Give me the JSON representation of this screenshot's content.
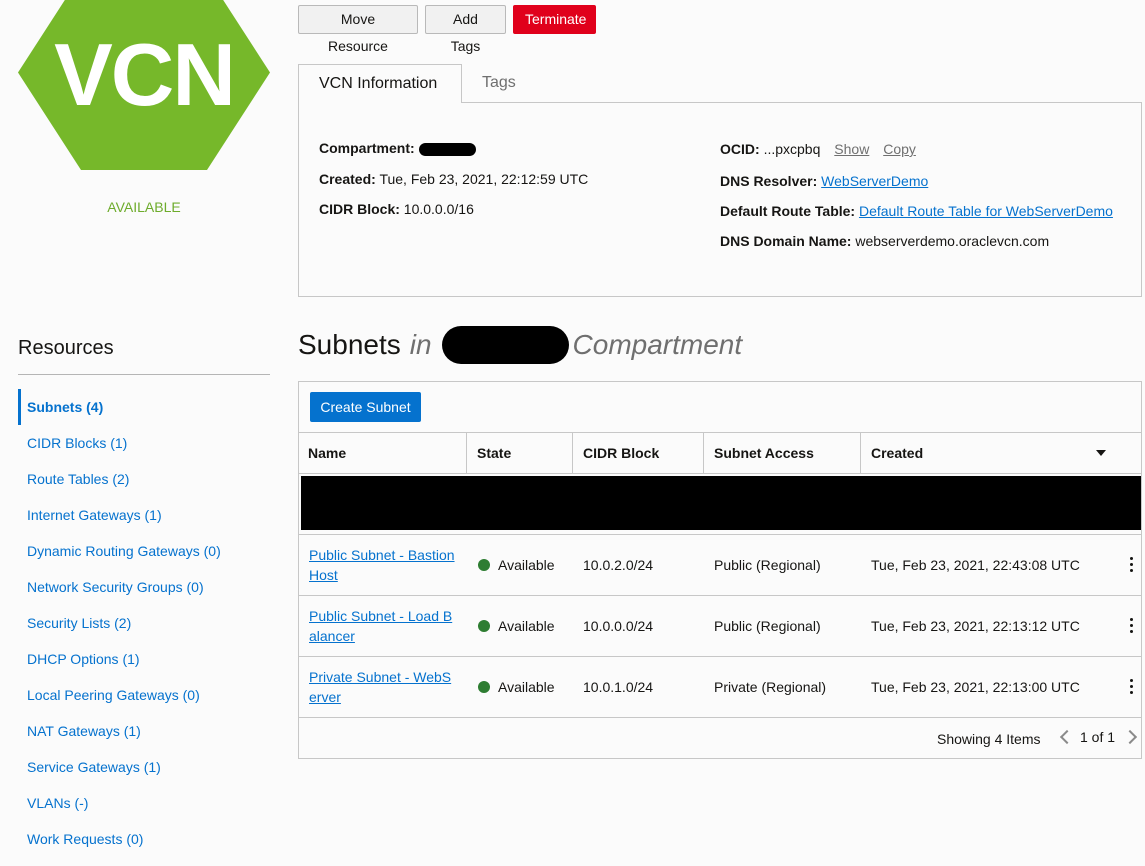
{
  "logo": {
    "text": "VCN",
    "color": "#76b82a"
  },
  "status": "AVAILABLE",
  "actions": {
    "move": "Move Resource",
    "add_tags": "Add Tags",
    "terminate": "Terminate"
  },
  "tabs": {
    "info": "VCN Information",
    "tags": "Tags"
  },
  "info": {
    "compartment_label": "Compartment:",
    "created_label": "Created:",
    "created_value": "Tue, Feb 23, 2021, 22:12:59 UTC",
    "cidr_label": "CIDR Block:",
    "cidr_value": "10.0.0.0/16",
    "ocid_label": "OCID:",
    "ocid_value": "...pxcpbq",
    "show": "Show",
    "copy": "Copy",
    "dns_resolver_label": "DNS Resolver:",
    "dns_resolver_value": "WebServerDemo",
    "route_table_label": "Default Route Table:",
    "route_table_value": "Default Route Table for WebServerDemo",
    "dns_domain_label": "DNS Domain Name:",
    "dns_domain_value": "webserverdemo.oraclevcn.com"
  },
  "resources": {
    "title": "Resources",
    "items": [
      {
        "label": "Subnets (4)"
      },
      {
        "label": "CIDR Blocks (1)"
      },
      {
        "label": "Route Tables (2)"
      },
      {
        "label": "Internet Gateways (1)"
      },
      {
        "label": "Dynamic Routing Gateways (0)"
      },
      {
        "label": "Network Security Groups (0)"
      },
      {
        "label": "Security Lists (2)"
      },
      {
        "label": "DHCP Options (1)"
      },
      {
        "label": "Local Peering Gateways (0)"
      },
      {
        "label": "NAT Gateways (1)"
      },
      {
        "label": "Service Gateways (1)"
      },
      {
        "label": "VLANs (-)"
      },
      {
        "label": "Work Requests (0)"
      }
    ]
  },
  "subnets": {
    "heading": "Subnets",
    "in": "in",
    "compartment": "Compartment",
    "create_button": "Create Subnet",
    "columns": {
      "name": "Name",
      "state": "State",
      "cidr": "CIDR Block",
      "access": "Subnet Access",
      "created": "Created"
    },
    "rows": [
      {
        "name_line1": "Public Subnet - Bastion",
        "name_line2": "Host",
        "state": "Available",
        "cidr": "10.0.2.0/24",
        "access": "Public (Regional)",
        "created": "Tue, Feb 23, 2021, 22:43:08 UTC"
      },
      {
        "name_line1": "Public Subnet - Load B",
        "name_line2": "alancer",
        "state": "Available",
        "cidr": "10.0.0.0/24",
        "access": "Public (Regional)",
        "created": "Tue, Feb 23, 2021, 22:13:12 UTC"
      },
      {
        "name_line1": "Private Subnet - WebS",
        "name_line2": "erver",
        "state": "Available",
        "cidr": "10.0.1.0/24",
        "access": "Private (Regional)",
        "created": "Tue, Feb 23, 2021, 22:13:00 UTC"
      }
    ],
    "showing": "Showing 4 Items",
    "page": "1 of 1"
  }
}
